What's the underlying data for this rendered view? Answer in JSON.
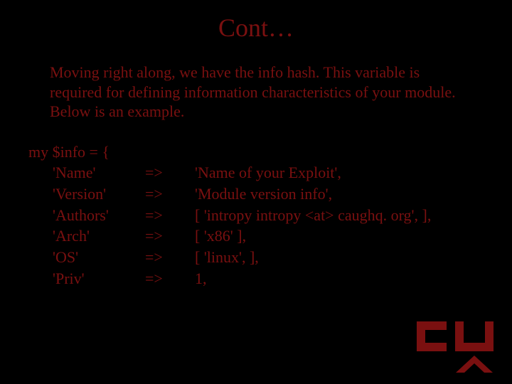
{
  "title": "Cont…",
  "paragraph": "Moving right along, we have the info hash.  This variable is required for defining information characteristics of your module.  Below is an example.",
  "code": {
    "open": "my $info = {",
    "rows": [
      {
        "key": "'Name'",
        "arrow": "=>",
        "value": "'Name of your Exploit',"
      },
      {
        "key": "'Version'",
        "arrow": "=>",
        "value": "'Module version info',"
      },
      {
        "key": "'Authors'",
        "arrow": "=>",
        "value": "[ 'intropy  intropy <at> caughq. org', ],"
      },
      {
        "key": "'Arch'",
        "arrow": "=>",
        "value": "[ 'x86' ],"
      },
      {
        "key": "'OS'",
        "arrow": "=>",
        "value": "[ 'linux', ],"
      },
      {
        "key": "'Priv'",
        "arrow": "=>",
        "value": "1,"
      }
    ]
  },
  "logo_name": "caughq-logo"
}
